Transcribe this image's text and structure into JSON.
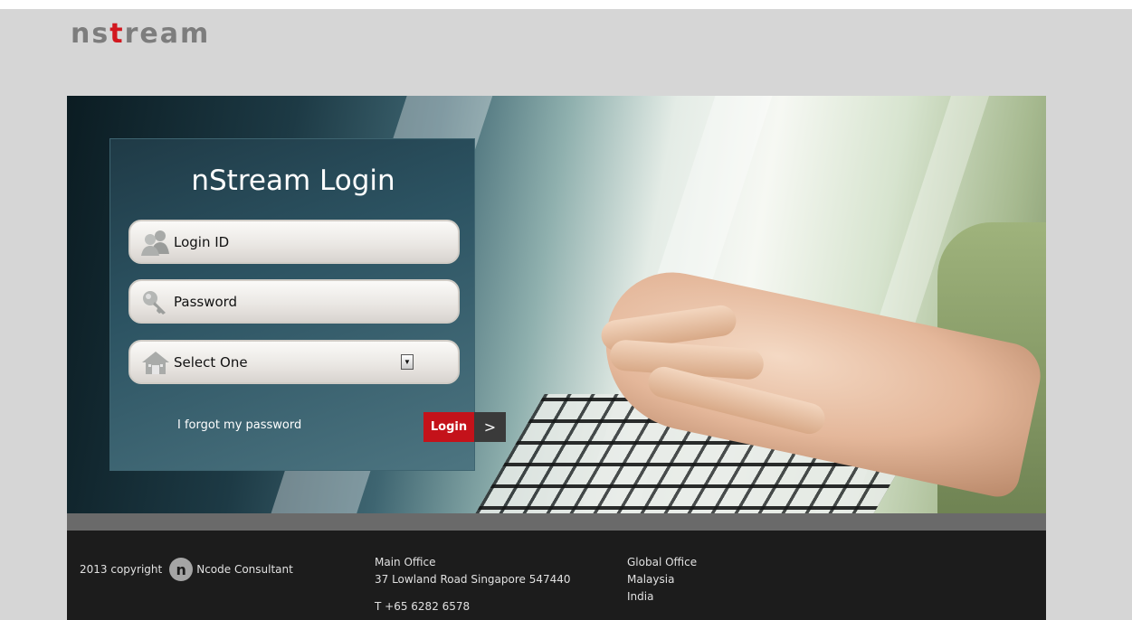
{
  "brand": {
    "logo_prefix": "ns",
    "logo_dot": "t",
    "logo_suffix": "ream"
  },
  "login": {
    "title": "nStream Login",
    "login_id_label": "Login ID",
    "password_label": "Password",
    "select_value": "Select One",
    "forgot_link": "I forgot my password",
    "submit_label": "Login",
    "submit_arrow": ">"
  },
  "footer": {
    "copyright_text": "2013 copyright",
    "company_logo_letter": "n",
    "company_name": "Ncode Consultant",
    "main_office_title": "Main Office",
    "main_office_address": "37 Lowland Road Singapore 547440",
    "main_office_phone": "T +65 6282 6578",
    "global_office_title": "Global Office",
    "global_offices": [
      "Malaysia",
      "India"
    ]
  },
  "icons": {
    "login_id": "users-icon",
    "password": "key-icon",
    "select": "home-icon"
  },
  "colors": {
    "accent_red": "#c4121a",
    "footer_bg": "#1c1c1c",
    "page_bg": "#d6d6d6",
    "panel_bg": "#2c5362"
  }
}
